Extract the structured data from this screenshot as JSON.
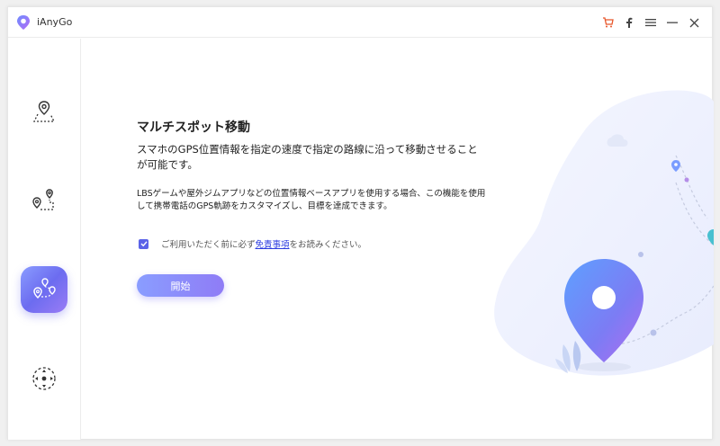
{
  "app": {
    "name": "iAnyGo"
  },
  "titlebar": {
    "actions": [
      "cart-icon",
      "facebook-icon",
      "menu-icon",
      "minimize-icon",
      "close-icon"
    ],
    "cart_color": "#e8562a"
  },
  "sidebar": {
    "items": [
      {
        "icon": "location-pin-icon",
        "active": false
      },
      {
        "icon": "two-spot-route-icon",
        "active": false
      },
      {
        "icon": "multi-spot-route-icon",
        "active": true
      },
      {
        "icon": "joystick-icon",
        "active": false
      }
    ]
  },
  "main": {
    "heading": "マルチスポット移動",
    "description": "スマホのGPS位置情報を指定の速度で指定の路線に沿って移動させることが可能です。",
    "detail": "LBSゲームや屋外ジムアプリなどの位置情報ベースアプリを使用する場合、この機能を使用して携帯電話のGPS軌跡をカスタマイズし、目標を達成できます。",
    "agreement": {
      "checked": true,
      "prefix": "ご利用いただく前に必ず",
      "link": "免責事項",
      "suffix": "をお読みください。"
    },
    "start_button": "開始"
  },
  "colors": {
    "accent": "#6c6cf0",
    "link": "#2b3be0"
  }
}
